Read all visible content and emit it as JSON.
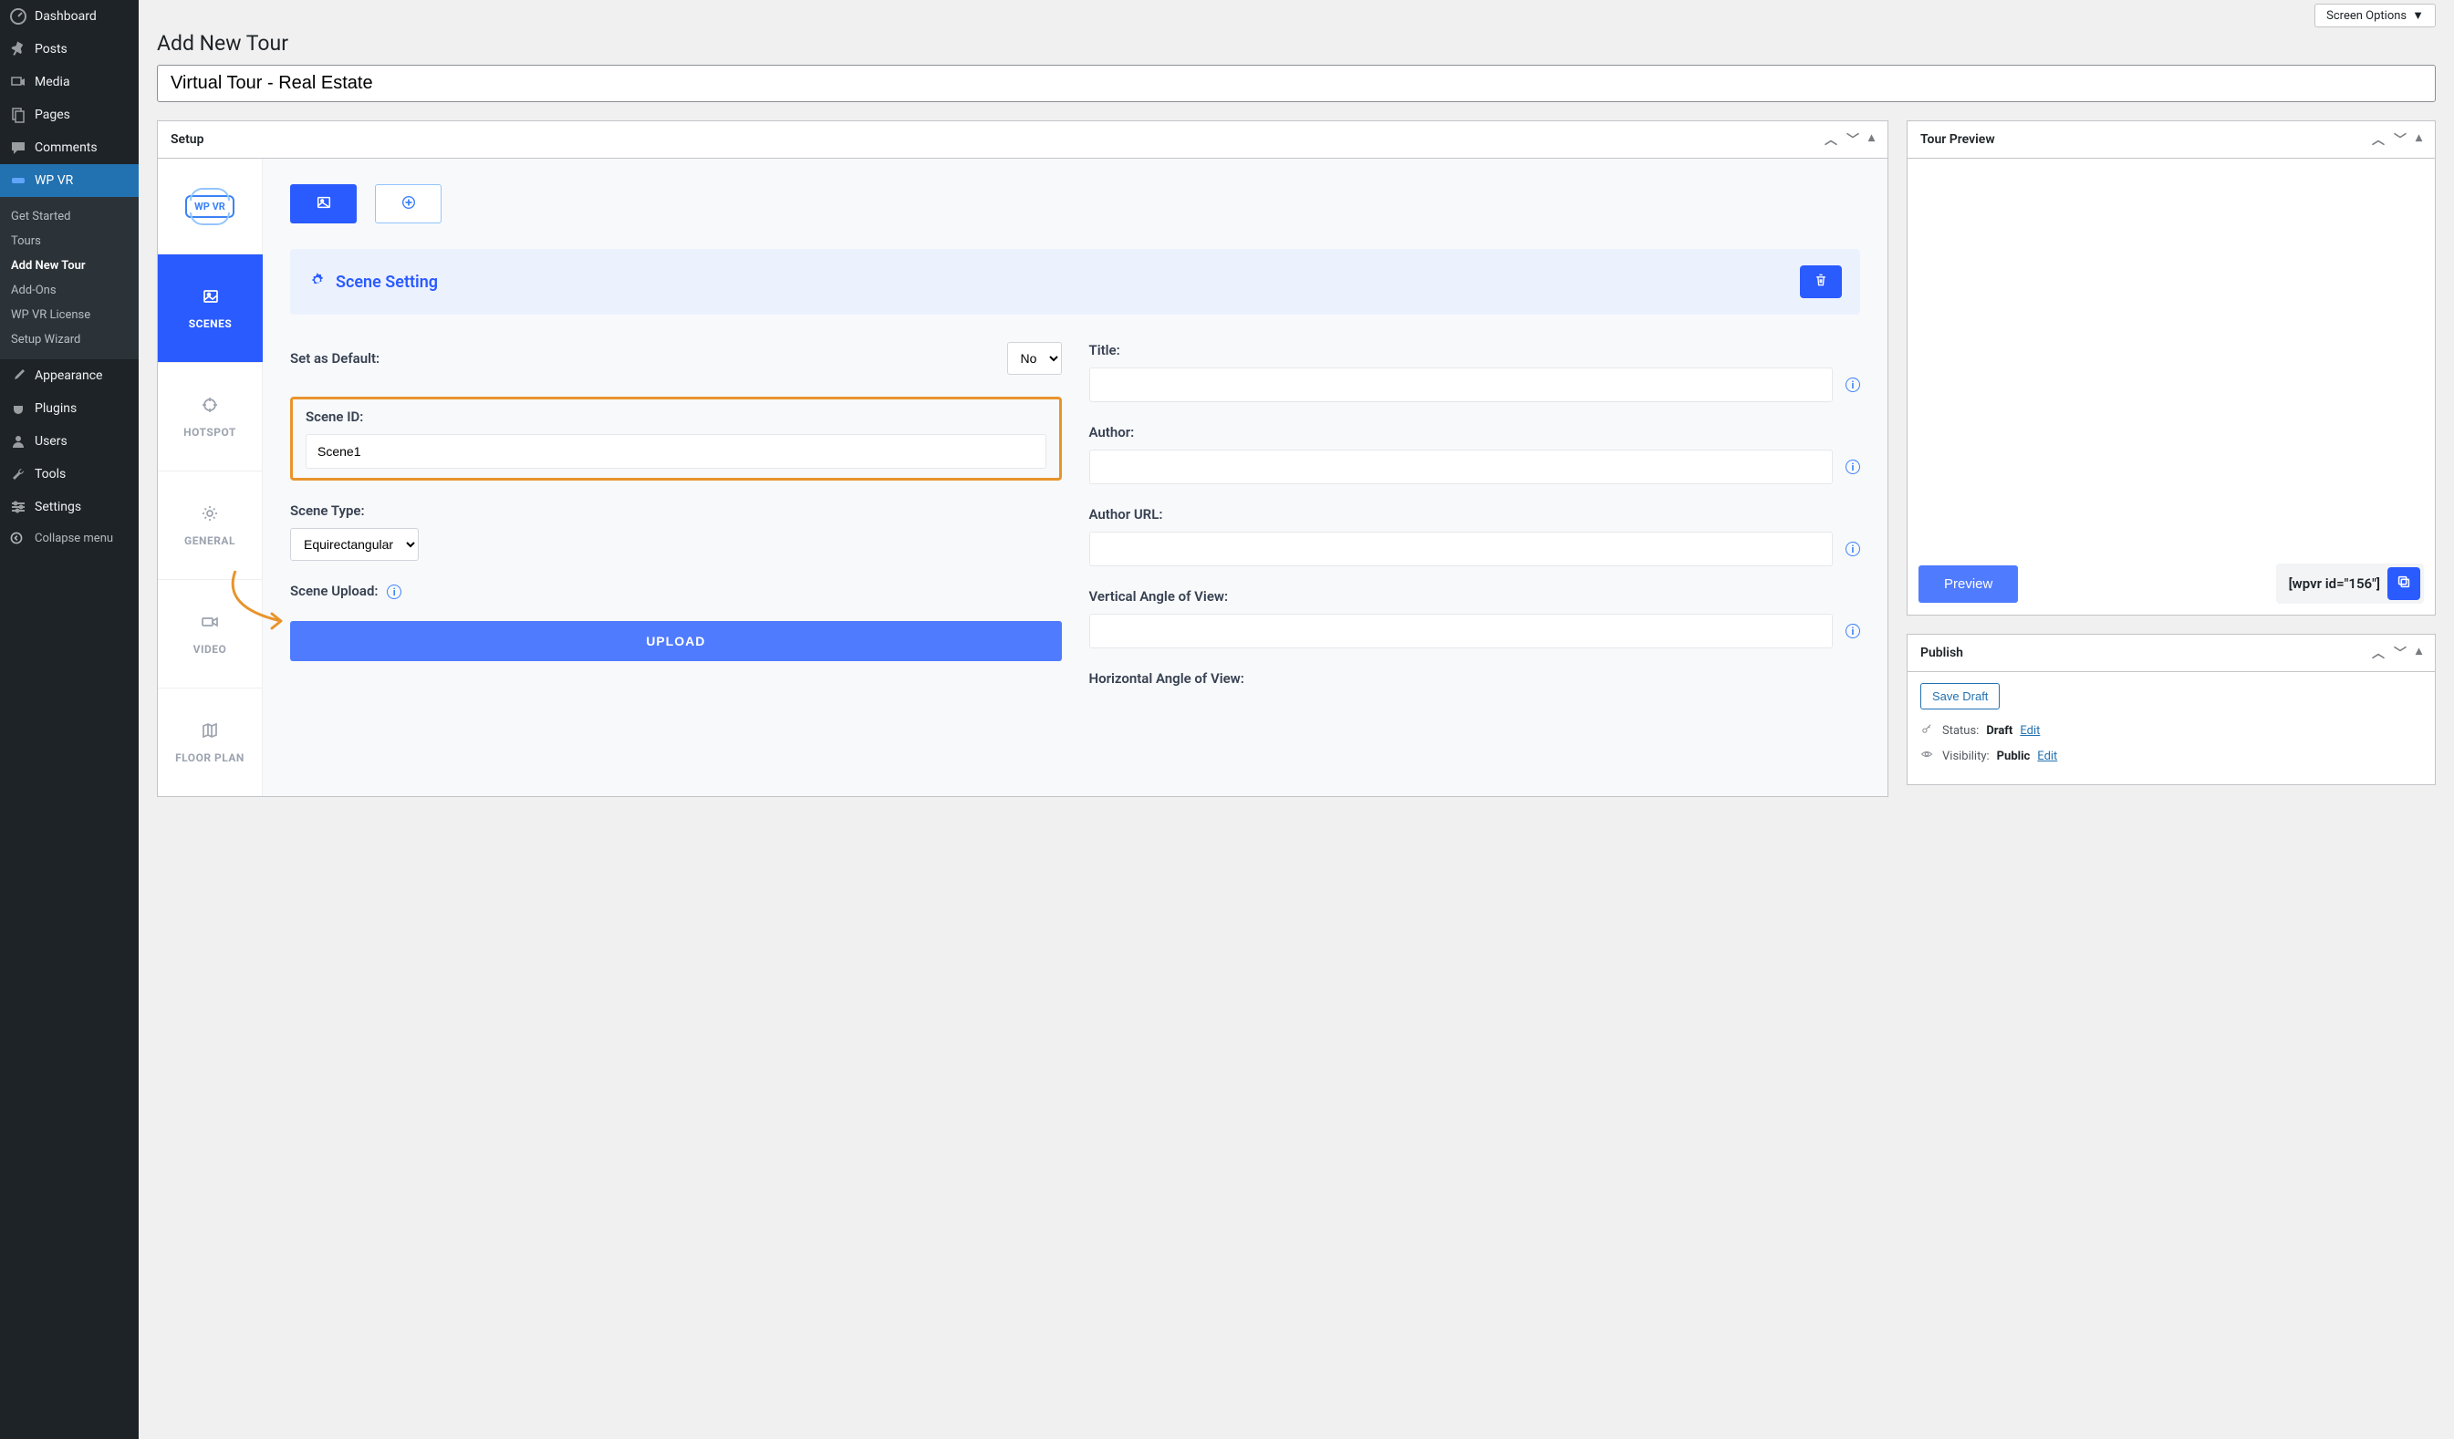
{
  "sidebar": {
    "items": [
      {
        "label": "Dashboard",
        "icon": "dashboard"
      },
      {
        "label": "Posts",
        "icon": "pin"
      },
      {
        "label": "Media",
        "icon": "media"
      },
      {
        "label": "Pages",
        "icon": "page"
      },
      {
        "label": "Comments",
        "icon": "comment"
      },
      {
        "label": "WP VR",
        "icon": "wpvr",
        "active": true
      },
      {
        "label": "Appearance",
        "icon": "brush"
      },
      {
        "label": "Plugins",
        "icon": "plug"
      },
      {
        "label": "Users",
        "icon": "user"
      },
      {
        "label": "Tools",
        "icon": "wrench"
      },
      {
        "label": "Settings",
        "icon": "sliders"
      }
    ],
    "wpvr_sub": [
      {
        "label": "Get Started"
      },
      {
        "label": "Tours"
      },
      {
        "label": "Add New Tour",
        "active": true
      },
      {
        "label": "Add-Ons"
      },
      {
        "label": "WP VR License"
      },
      {
        "label": "Setup Wizard"
      }
    ],
    "collapse_label": "Collapse menu"
  },
  "top": {
    "screen_options": "Screen Options"
  },
  "page": {
    "title": "Add New Tour",
    "post_title_value": "Virtual Tour - Real Estate"
  },
  "setup": {
    "panel_title": "Setup",
    "vtabs": [
      {
        "label": "SCENES",
        "active": true
      },
      {
        "label": "HOTSPOT"
      },
      {
        "label": "GENERAL"
      },
      {
        "label": "VIDEO"
      },
      {
        "label": "FLOOR PLAN"
      }
    ],
    "scene_setting_title": "Scene Setting",
    "fields": {
      "set_default_label": "Set as Default:",
      "set_default_value": "No",
      "scene_id_label": "Scene ID:",
      "scene_id_value": "Scene1",
      "scene_type_label": "Scene Type:",
      "scene_type_value": "Equirectangular",
      "scene_upload_label": "Scene Upload:",
      "upload_btn": "UPLOAD",
      "title_label": "Title:",
      "title_value": "",
      "author_label": "Author:",
      "author_value": "",
      "author_url_label": "Author URL:",
      "author_url_value": "",
      "vertical_angle_label": "Vertical Angle of View:",
      "vertical_angle_value": "",
      "horizontal_angle_label": "Horizontal Angle of View:"
    }
  },
  "preview": {
    "panel_title": "Tour Preview",
    "preview_btn": "Preview",
    "shortcode": "[wpvr id=\"156\"]"
  },
  "publish": {
    "panel_title": "Publish",
    "save_draft": "Save Draft",
    "status_label": "Status:",
    "status_value": "Draft",
    "visibility_label": "Visibility:",
    "visibility_value": "Public",
    "edit_label": "Edit"
  }
}
